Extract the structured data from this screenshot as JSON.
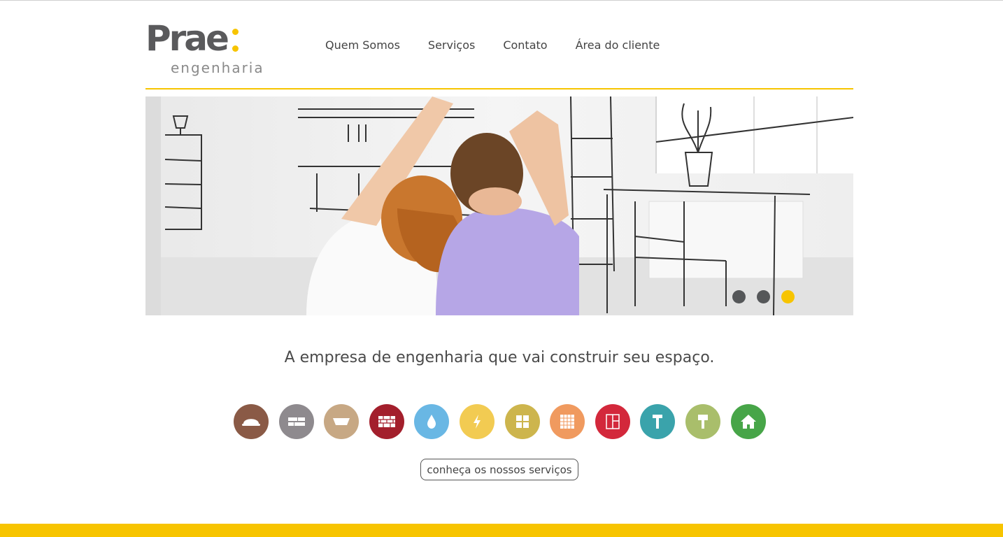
{
  "brand": {
    "name": "Prae",
    "tagline_word": "engenharia",
    "accent_color": "#f7c400"
  },
  "nav": [
    {
      "label": "Quem Somos"
    },
    {
      "label": "Serviços"
    },
    {
      "label": "Contato"
    },
    {
      "label": "Área do cliente"
    }
  ],
  "hero": {
    "slide_count": 3,
    "active_slide": 3
  },
  "headline": "A empresa de engenharia que vai construir seu espaço.",
  "services": [
    {
      "icon": "helmet-icon",
      "color": "#8a5a46"
    },
    {
      "icon": "blocks-icon",
      "color": "#8e8a8e"
    },
    {
      "icon": "bowl-icon",
      "color": "#c7a884"
    },
    {
      "icon": "bricks-icon",
      "color": "#a31f2c"
    },
    {
      "icon": "water-drop-icon",
      "color": "#69b7e4"
    },
    {
      "icon": "lightning-icon",
      "color": "#f2cb52"
    },
    {
      "icon": "window-icon",
      "color": "#cdb54d"
    },
    {
      "icon": "tiles-icon",
      "color": "#f09a5f"
    },
    {
      "icon": "door-icon",
      "color": "#d3283b"
    },
    {
      "icon": "hammer-icon",
      "color": "#3aa3ab"
    },
    {
      "icon": "paint-roller-icon",
      "color": "#a9be6b"
    },
    {
      "icon": "house-icon",
      "color": "#47a548"
    }
  ],
  "cta_label": "conheça os nossos serviços"
}
